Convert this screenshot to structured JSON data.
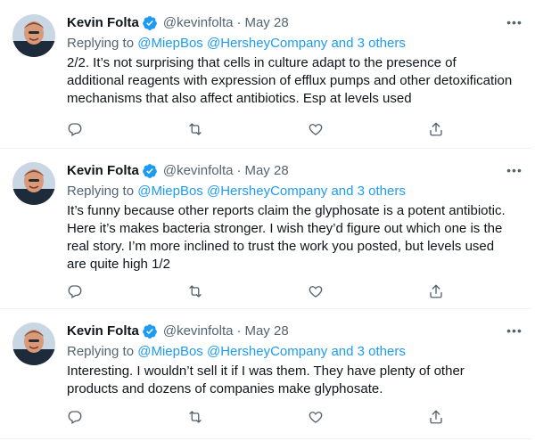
{
  "tweets": [
    {
      "name": "Kevin Folta",
      "handle": "@kevinfolta",
      "date": "May 28",
      "replying_prefix": "Replying to",
      "mentions": [
        "@MiepBos",
        "@HersheyCompany",
        "and 3 others"
      ],
      "lines": [
        "2/2. It’s not surprising that cells in culture adapt to the presence of",
        "additional reagents with expression of efflux pumps and other detoxification",
        "mechanisms that also affect antibiotics. Esp at levels used"
      ]
    },
    {
      "name": "Kevin Folta",
      "handle": "@kevinfolta",
      "date": "May 28",
      "replying_prefix": "Replying to",
      "mentions": [
        "@MiepBos",
        "@HersheyCompany",
        "and 3 others"
      ],
      "lines": [
        "It’s funny because other reports claim the glyphosate is a potent antibiotic.",
        "Here it’s makes bacteria stronger. I wish they’d figure out which one is the",
        "real story. I’m more inclined to trust the work you posted, but levels used",
        "are quite high 1/2"
      ]
    },
    {
      "name": "Kevin Folta",
      "handle": "@kevinfolta",
      "date": "May 28",
      "replying_prefix": "Replying to",
      "mentions": [
        "@MiepBos",
        "@HersheyCompany",
        "and 3 others"
      ],
      "lines": [
        "Interesting.  I wouldn’t sell it if I was them. They have plenty of other",
        "products and dozens of companies make glyphosate."
      ]
    }
  ],
  "separator": "·",
  "more_glyph": "•••",
  "icons": {
    "reply": "reply-icon",
    "retweet": "retweet-icon",
    "like": "like-icon",
    "share": "share-icon",
    "verified": "verified-badge-icon",
    "more": "more-icon"
  },
  "colors": {
    "text": "#0f1419",
    "secondary": "#536471",
    "link": "#1d9bf0",
    "divider": "#eff3f4"
  }
}
